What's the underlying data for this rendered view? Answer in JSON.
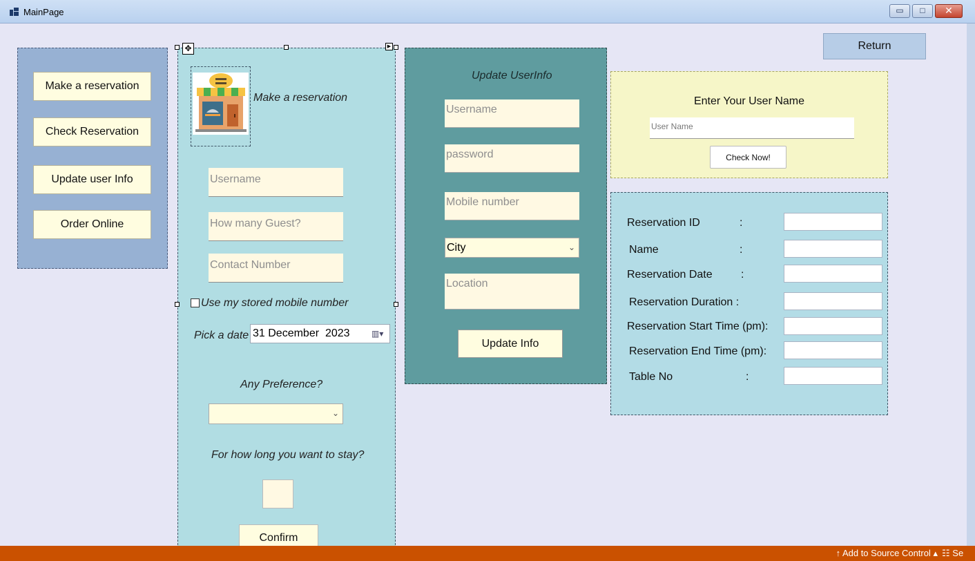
{
  "window": {
    "title": "MainPage",
    "minimize_glyph": "▭",
    "maximize_glyph": "□",
    "close_glyph": "✕"
  },
  "nav": {
    "items": [
      {
        "label": "Make a reservation"
      },
      {
        "label": "Check Reservation"
      },
      {
        "label": "Update user Info"
      },
      {
        "label": "Order Online"
      }
    ]
  },
  "reservation": {
    "heading": "Make a reservation",
    "username_placeholder": "Username",
    "guests_placeholder": "How many Guest?",
    "contact_placeholder": "Contact Number",
    "use_stored_label": "Use my stored mobile number",
    "pick_date_label": "Pick a date",
    "date_value": "31 December  2023",
    "preference_label": "Any Preference?",
    "preference_value": "",
    "stay_label": "For how long you want to stay?",
    "confirm_label": "Confirm"
  },
  "update": {
    "heading": "Update UserInfo",
    "username_placeholder": "Username",
    "password_placeholder": "password",
    "mobile_placeholder": "Mobile number",
    "city_value": "City",
    "location_placeholder": "Location",
    "button_label": "Update Info"
  },
  "return_label": "Return",
  "check": {
    "title": "Enter Your User Name",
    "input_placeholder": "User Name",
    "button_label": "Check Now!"
  },
  "details": {
    "rows": [
      {
        "label": "Reservation ID",
        "colon": ":"
      },
      {
        "label": "Name",
        "colon": ":"
      },
      {
        "label": "Reservation Date",
        "colon": ":"
      },
      {
        "label": "Reservation Duration :",
        "colon": ""
      },
      {
        "label": "Reservation Start Time (pm):",
        "colon": ""
      },
      {
        "label": "Reservation End Time (pm):",
        "colon": ""
      },
      {
        "label": "Table No",
        "colon": ":"
      }
    ]
  },
  "statusbar": {
    "source_control": "↑  Add to Source Control  ▴",
    "right_label": "Se"
  },
  "colors": {
    "accent": "#ca5100",
    "nav_panel": "#97b1d3",
    "reservation_panel": "#b1dde3",
    "update_panel": "#5f9c9f",
    "check_panel": "#f6f6c8"
  }
}
